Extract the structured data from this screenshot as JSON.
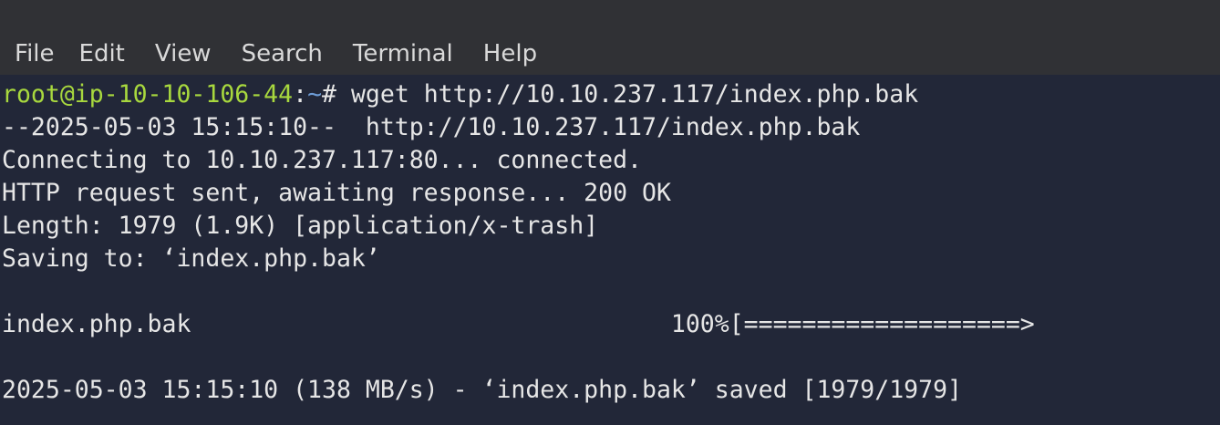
{
  "menu": {
    "items": [
      "File",
      "Edit",
      "View",
      "Search",
      "Terminal",
      "Help"
    ]
  },
  "terminal": {
    "prompt": {
      "user_host": "root@ip-10-10-106-44",
      "sep": ":",
      "path": "~",
      "symbol": "# ",
      "command": "wget http://10.10.237.117/index.php.bak"
    },
    "lines": [
      "--2025-05-03 15:15:10--  http://10.10.237.117/index.php.bak",
      "Connecting to 10.10.237.117:80... connected.",
      "HTTP request sent, awaiting response... 200 OK",
      "Length: 1979 (1.9K) [application/x-trash]",
      "Saving to: ‘index.php.bak’",
      "",
      "index.php.bak                                 100%[===================>",
      "",
      "2025-05-03 15:15:10 (138 MB/s) - ‘index.php.bak’ saved [1979/1979]"
    ]
  },
  "colors": {
    "background": "#222738",
    "menubar": "#303135",
    "prompt_user": "#a8d83e",
    "prompt_path": "#6d9cd6",
    "text": "#e6e6e6"
  }
}
